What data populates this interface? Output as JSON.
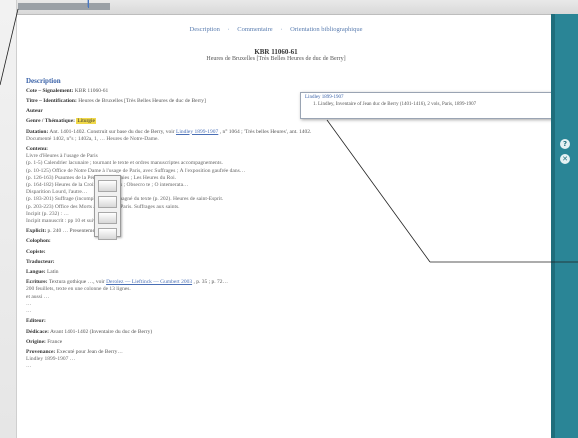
{
  "tabs": [
    "Description",
    "Commentaire",
    "Orientation bibliographique"
  ],
  "doc": {
    "id": "KBR 11060-61",
    "subtitle": "Heures de Bruxelles [Très Belles Heures de duc de Berry]"
  },
  "section_title": "Description",
  "popup": {
    "title": "Lindley 1899-1907",
    "detail": "1. Lindley, Inventaire of Jean duc de Berry (1401-1416), 2 vols, Paris, 1899-1907"
  },
  "fields": {
    "cote_label": "Cote – Signalement:",
    "cote_value": "KBR 11060-61",
    "titre_label": "Titre – Identification:",
    "titre_value": "Heures de Bruxelles [Très Belles Heures de duc de Berry]",
    "auteur_label": "Auteur",
    "genre_label": "Genre / Thématique:",
    "genre_value": "Liturgie",
    "datation_label": "Datation:",
    "datation_value": "Ant. 1401-1402. Construit sur base du duc de Berry, voir",
    "datation_link": "Lindley 1899-1907",
    "datation_tail": ", n° 1064 ; 'Très belles Heures', ant. 1402.",
    "datation2": "Documenté 1402, n°s ; 1402a, 1, … Heures de Notre-Dame.",
    "contenu_label": "Contenu:",
    "contenu_lines": [
      "Livre d'Heures à l'usage de Paris",
      "(p. 1-5) Calendrier lacunaire ; tournant le texte et ordres manuscriptes accompagnements.",
      "(p. 10-125) Office de Notre Dame à l'usage de Paris, avec Suffrages ; À l'exposition gaufrée dans…",
      "(p. 126-163) Psaumes de la Pénitence, Litanies ; Les Heures du Roi.",
      "(p. 164-182) Heures de la Croix ; Evangiles ; Obsecro te ; O intemerata…",
      "Disparition Lourd, l'autre…",
      "(p. 183-201) Suffrage (incomplet) ; accompagné du texte (p. 202). Heures de saint-Esprit.",
      "(p. 203-223) Office des Morts à l'usage de Paris. Suffrages aux saints.",
      "Incipit (p. 232) : …",
      "Incipit manuscrit : pp 10 et suivant…"
    ],
    "explicit_label": "Explicit:",
    "explicit_value": "p. 240 … Presentement …",
    "colophon_label": "Colophon:",
    "copiste_label": "Copiste:",
    "traducteur_label": "Traducteur:",
    "langue_label": "Langue:",
    "langue_value": "Latin",
    "ecriture_label": "Écriture:",
    "ecriture_value": "Textura gothique …, voir",
    "ecriture_link": "Derolez — Lieftinck — Gumbert 2003",
    "ecriture_tail": ", p. 35 ; p. 72…",
    "ecriture_lines": [
      "200 feuillets, texte en une colonne de 13 lignes.",
      "et aussi …",
      "…",
      "…"
    ],
    "editeur_label": "Éditeur:",
    "dedicace_label": "Dédicace:",
    "dedicace_value": "Avant 1401-1402 (Inventaire du duc de Berry)",
    "origine_label": "Origine:",
    "origine_value": "France",
    "provenance_label": "Provenance:",
    "provenance_lines": [
      "Executé pour Jean de Berry…",
      "Lindley 1899-1907 …",
      "…"
    ]
  },
  "colors": {
    "accent": "#3a62a8",
    "link": "#4a6fb5",
    "highlight": "#f1d94a",
    "sidebar": "#2a8596"
  },
  "icons": [
    "question-icon",
    "close-icon"
  ]
}
